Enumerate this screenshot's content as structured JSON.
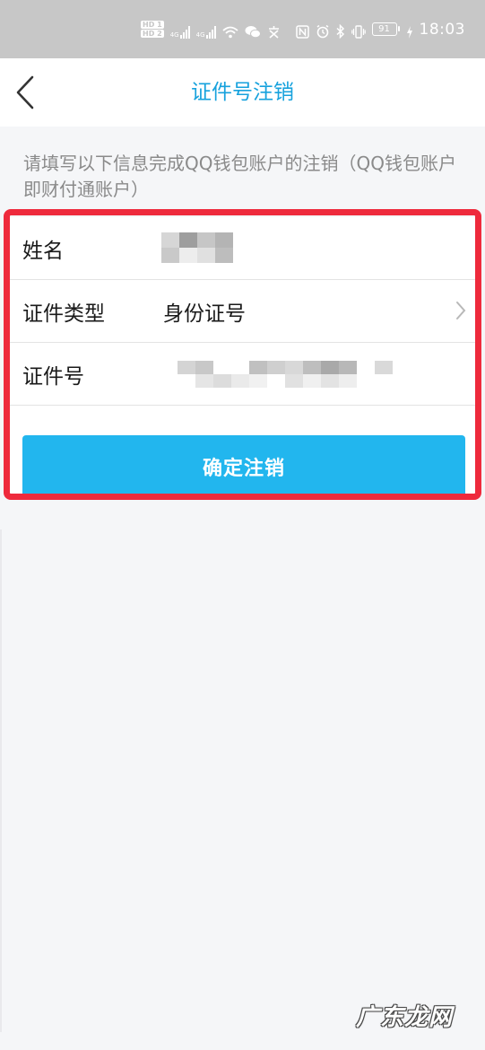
{
  "status_bar": {
    "hd1": "HD 1",
    "hd2": "HD 2",
    "network1": "4G",
    "network2": "4G",
    "battery": "91",
    "time": "18:03"
  },
  "nav": {
    "title": "证件号注销"
  },
  "description": "请填写以下信息完成QQ钱包账户的注销（QQ钱包账户即财付通账户）",
  "form": {
    "name_label": "姓名",
    "id_type_label": "证件类型",
    "id_type_value": "身份证号",
    "id_number_label": "证件号"
  },
  "confirm_button": "确定注销",
  "watermark": "广东龙网",
  "colors": {
    "accent": "#22b6ee",
    "title_blue": "#17a2dd",
    "highlight_red": "#ee2a3c"
  }
}
